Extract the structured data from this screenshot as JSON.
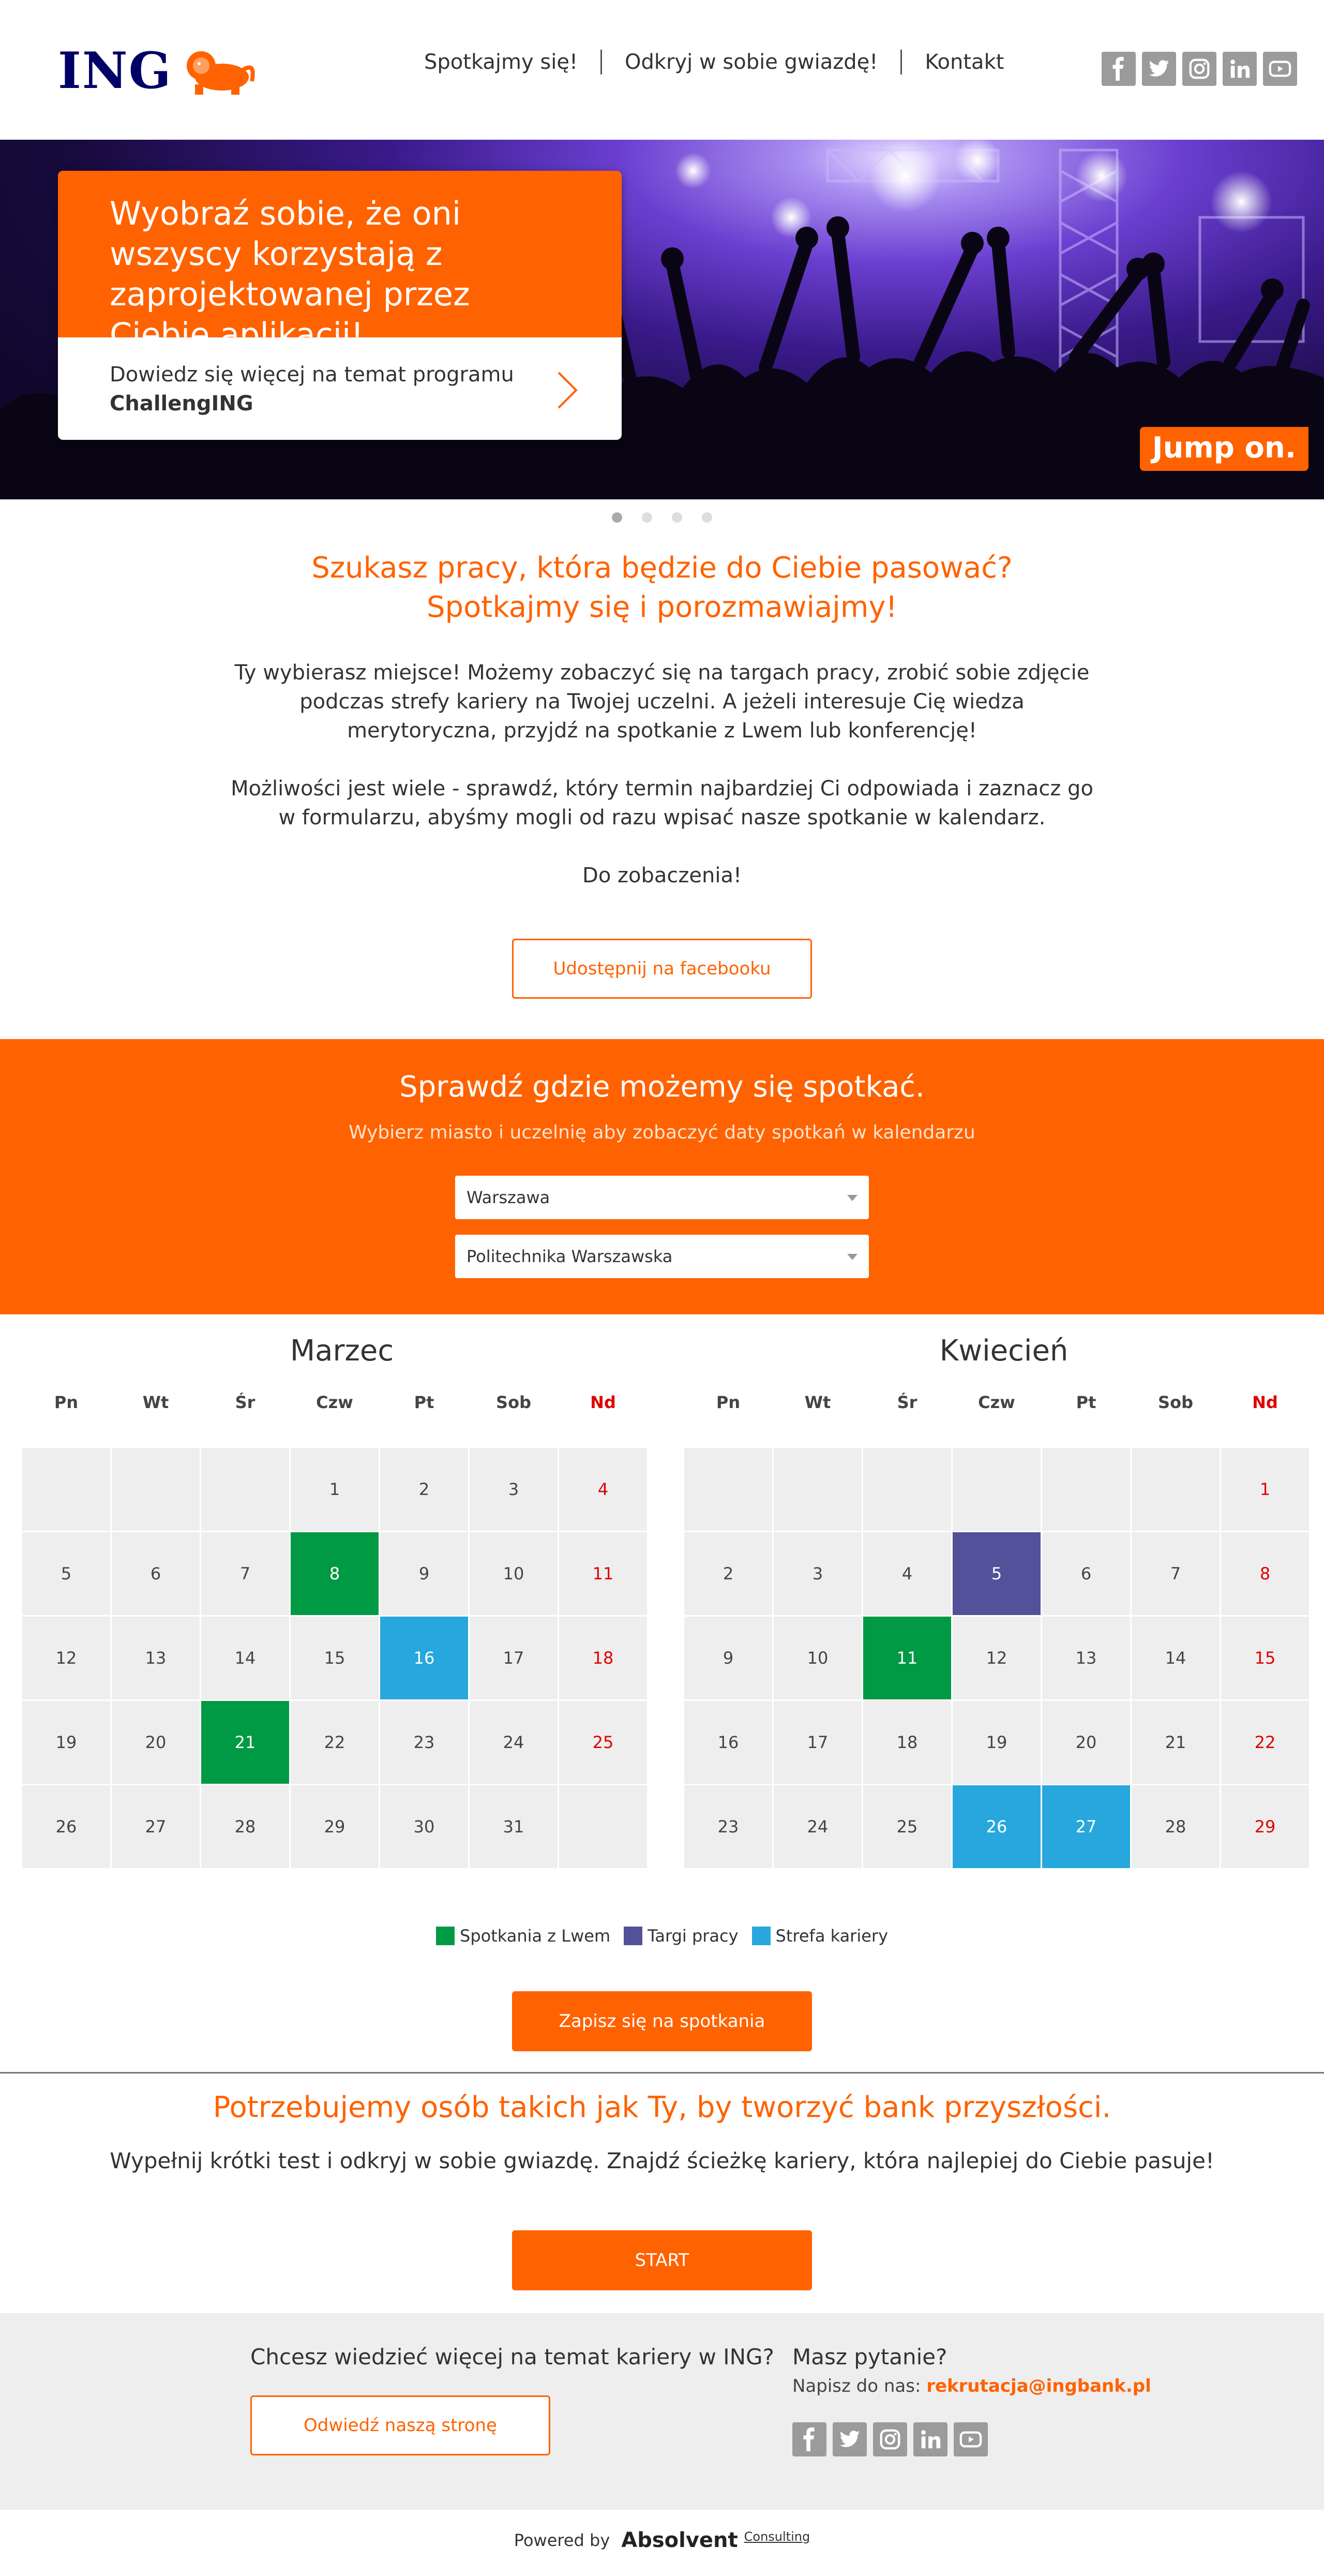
{
  "header": {
    "logo_text": "ING",
    "nav": [
      "Spotkajmy się!",
      "Odkryj w sobie gwiazdę!",
      "Kontakt"
    ],
    "social": [
      "facebook-icon",
      "twitter-icon",
      "instagram-icon",
      "linkedin-icon",
      "youtube-icon"
    ]
  },
  "hero": {
    "headline": "Wyobraź sobie, że oni wszyscy korzystają z zaprojektowanej przez Ciebie aplikacji!",
    "link_text": "Dowiedz się więcej na temat programu",
    "link_bold": "ChallengING",
    "badge": "Jump on.",
    "slides": 4,
    "active_slide": 1
  },
  "intro": {
    "title_line1": "Szukasz pracy, która będzie do Ciebie pasować?",
    "title_line2": "Spotkajmy się i porozmawiajmy!",
    "p1": "Ty wybierasz miejsce! Możemy zobaczyć się na targach pracy, zrobić sobie zdjęcie podczas strefy kariery na Twojej uczelni. A jeżeli interesuje Cię wiedza merytoryczna, przyjdź na spotkanie z Lwem lub konferencję!",
    "p2": "Możliwości jest wiele - sprawdź, który termin najbardziej Ci odpowiada i zaznacz go w formularzu, abyśmy mogli od razu wpisać nasze spotkanie w kalendarz.",
    "p3": "Do zobaczenia!",
    "share_button": "Udostępnij na facebooku"
  },
  "meet": {
    "title": "Sprawdź gdzie możemy się spotkać.",
    "subtitle": "Wybierz miasto i uczelnię aby zobaczyć daty spotkań w kalendarzu",
    "city": "Warszawa",
    "university": "Politechnika Warszawska"
  },
  "weekdays": [
    "Pn",
    "Wt",
    "Śr",
    "Czw",
    "Pt",
    "Sob",
    "Nd"
  ],
  "calendars": [
    {
      "month": "Marzec",
      "offset": 3,
      "days": 31,
      "events": {
        "8": "lion",
        "16": "zone",
        "21": "lion"
      }
    },
    {
      "month": "Kwiecień",
      "offset": 6,
      "days": 29,
      "events": {
        "5": "fair",
        "11": "lion",
        "26": "zone",
        "27": "zone"
      }
    }
  ],
  "legend": [
    {
      "label": "Spotkania z Lwem",
      "color": "#009a44"
    },
    {
      "label": "Targi pracy",
      "color": "#525199"
    },
    {
      "label": "Strefa kariery",
      "color": "#27a7dd"
    }
  ],
  "signup_button": "Zapisz się na spotkania",
  "future": {
    "title": "Potrzebujemy osób takich jak Ty, by tworzyć bank przyszłości.",
    "text": "Wypełnij krótki test i odkryj w sobie gwiazdę. Znajdź ścieżkę kariery, która najlepiej do Ciebie pasuje!",
    "start_button": "START"
  },
  "footer": {
    "question_left": "Chcesz wiedzieć więcej na temat kariery w ING?",
    "visit_button": "Odwiedź naszą stronę",
    "question_right": "Masz pytanie?",
    "write_to": "Napisz do nas: ",
    "email": "rekrutacja@ingbank.pl"
  },
  "powered": {
    "label": "Powered by",
    "brand": "Absolvent",
    "brand_sub": "Consulting"
  },
  "colors": {
    "accent": "#ff6200",
    "brand_navy": "#000066",
    "lion": "#009a44",
    "fair": "#525199",
    "zone": "#27a7dd"
  }
}
